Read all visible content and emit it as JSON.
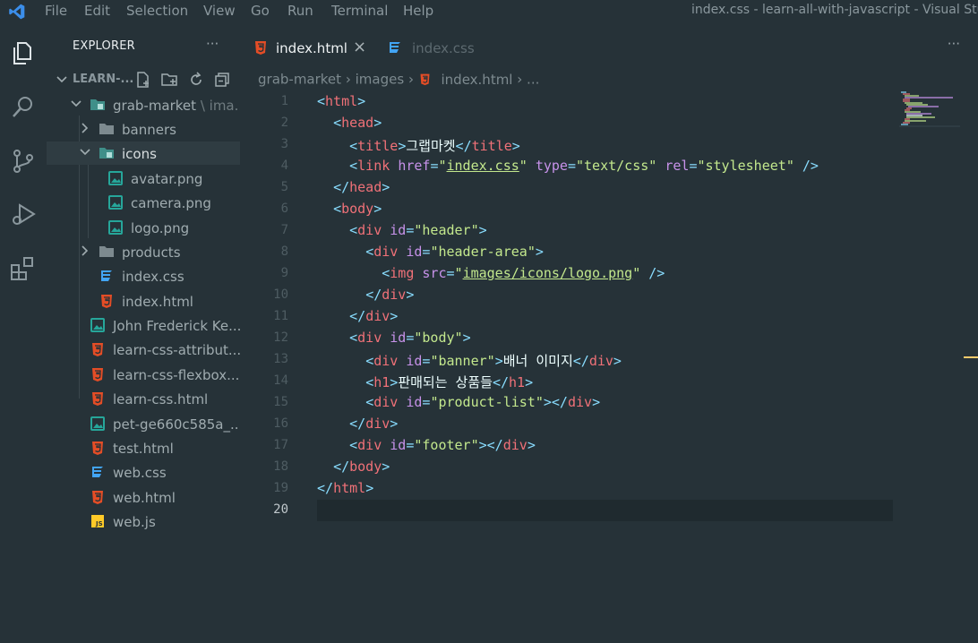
{
  "menu": [
    "File",
    "Edit",
    "Selection",
    "View",
    "Go",
    "Run",
    "Terminal",
    "Help"
  ],
  "window_title": "index.css - learn-all-with-javascript - Visual Studi",
  "sidebar": {
    "title": "EXPLORER",
    "more": "···",
    "root_label": "LEARN-...",
    "tree": [
      {
        "label": "grab-market",
        "suffix": "\\ ima...",
        "type": "folder-open"
      },
      {
        "label": "banners",
        "type": "folder-closed"
      },
      {
        "label": "icons",
        "type": "folder-open"
      },
      {
        "label": "avatar.png",
        "type": "image"
      },
      {
        "label": "camera.png",
        "type": "image"
      },
      {
        "label": "logo.png",
        "type": "image"
      },
      {
        "label": "products",
        "type": "folder-closed"
      },
      {
        "label": "index.css",
        "type": "css"
      },
      {
        "label": "index.html",
        "type": "html"
      },
      {
        "label": "John Frederick Ke...",
        "type": "image"
      },
      {
        "label": "learn-css-attribut...",
        "type": "html"
      },
      {
        "label": "learn-css-flexbox....",
        "type": "html"
      },
      {
        "label": "learn-css.html",
        "type": "html"
      },
      {
        "label": "pet-ge660c585a_...",
        "type": "image"
      },
      {
        "label": "test.html",
        "type": "html"
      },
      {
        "label": "web.css",
        "type": "css"
      },
      {
        "label": "web.html",
        "type": "html"
      },
      {
        "label": "web.js",
        "type": "js"
      }
    ]
  },
  "tabs": [
    {
      "label": "index.html",
      "close": "×",
      "active": true
    },
    {
      "label": "index.css",
      "active": false
    }
  ],
  "tabs_more": "···",
  "breadcrumb": [
    "grab-market",
    "images",
    "index.html",
    "..."
  ],
  "code": {
    "current_line": 20,
    "lines": [
      "1",
      "2",
      "3",
      "4",
      "5",
      "6",
      "7",
      "8",
      "9",
      "10",
      "11",
      "12",
      "13",
      "14",
      "15",
      "16",
      "17",
      "18",
      "19",
      "20"
    ],
    "korean": {
      "title_text": "그랩마켓",
      "banner_text": "배너 이미지",
      "h1_text": "판매되는 상품들"
    },
    "strings": {
      "css_href": "index.css",
      "type_val": "text/css",
      "rel_val": "stylesheet",
      "header": "header",
      "header_area": "header-area",
      "img_src": "images/icons/logo.png",
      "body": "body",
      "banner": "banner",
      "product_list": "product-list",
      "footer": "footer"
    }
  },
  "colors": {
    "background": "#263238",
    "tag": "#f07178",
    "punct": "#89ddff",
    "attr": "#c792ea",
    "string": "#c3e88d",
    "text": "#eeffff",
    "html_icon": "#e44d26",
    "css_icon": "#42a5f5",
    "js_icon": "#ffca28",
    "image_icon": "#26a69a"
  }
}
